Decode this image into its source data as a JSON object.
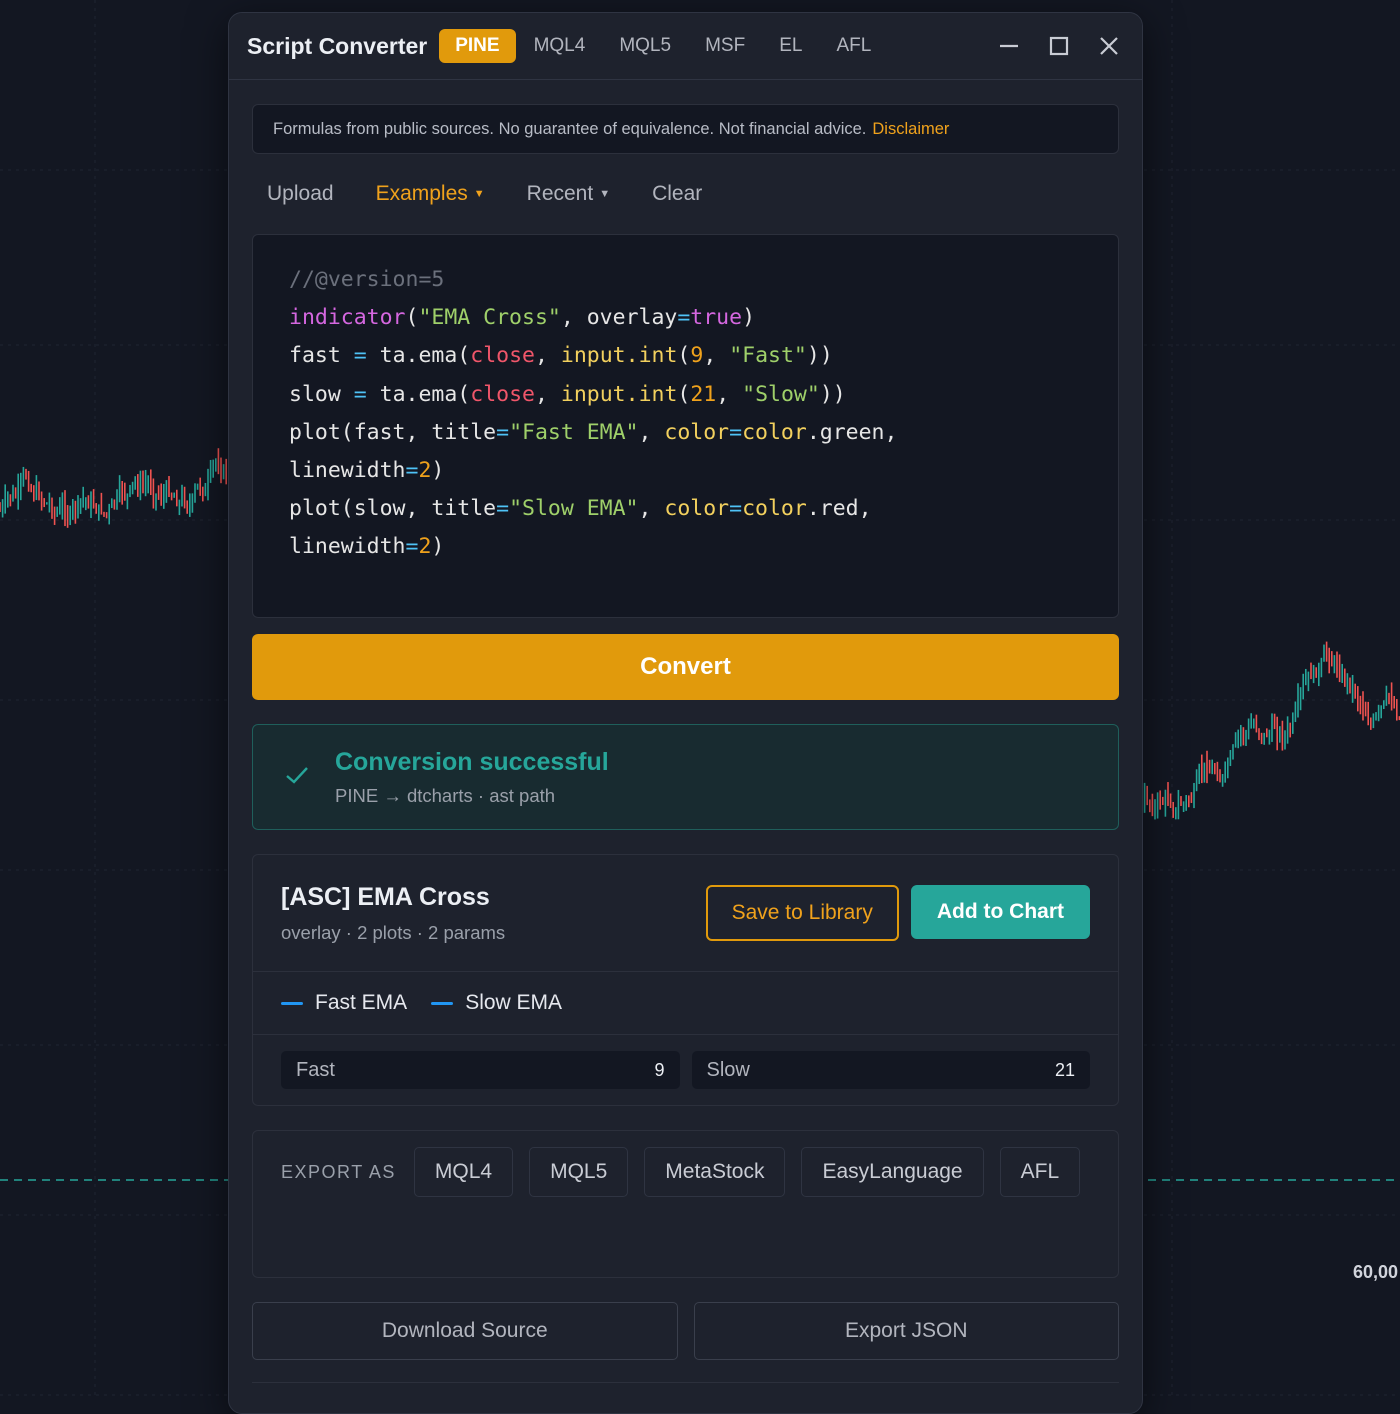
{
  "chart": {
    "price_label": "60,00"
  },
  "window": {
    "title": "Script Converter",
    "lang_tabs": [
      {
        "label": "PINE",
        "active": true
      },
      {
        "label": "MQL4"
      },
      {
        "label": "MQL5"
      },
      {
        "label": "MSF"
      },
      {
        "label": "EL"
      },
      {
        "label": "AFL"
      }
    ],
    "controls": {
      "minimize": "minimize-icon",
      "maximize": "maximize-icon",
      "close": "close-icon"
    }
  },
  "disclaimer": {
    "text": "Formulas from public sources. No guarantee of equivalence. Not financial advice.",
    "link": "Disclaimer"
  },
  "toolbar": {
    "upload": "Upload",
    "examples": "Examples",
    "recent": "Recent",
    "clear": "Clear"
  },
  "editor": {
    "language": "pine",
    "lines": [
      "//@version=5",
      "indicator(\"EMA Cross\", overlay=true)",
      "fast = ta.ema(close, input.int(9, \"Fast\"))",
      "slow = ta.ema(close, input.int(21, \"Slow\"))",
      "plot(fast, title=\"Fast EMA\", color=color.green,",
      "linewidth=2)",
      "plot(slow, title=\"Slow EMA\", color=color.red,",
      "linewidth=2)"
    ]
  },
  "convert": {
    "label": "Convert"
  },
  "status": {
    "title": "Conversion successful",
    "subtitle": "PINE → dtcharts · ast path",
    "color": "#26a69a"
  },
  "result": {
    "title": "[ASC] EMA Cross",
    "meta": "overlay · 2 plots · 2 params",
    "save_label": "Save to Library",
    "add_label": "Add to Chart",
    "plots": [
      {
        "name": "Fast EMA",
        "color": "#2196f3"
      },
      {
        "name": "Slow EMA",
        "color": "#2196f3"
      }
    ],
    "params": [
      {
        "name": "Fast",
        "value": "9"
      },
      {
        "name": "Slow",
        "value": "21"
      }
    ]
  },
  "export": {
    "label": "EXPORT AS",
    "formats": [
      "MQL4",
      "MQL5",
      "MetaStock",
      "EasyLanguage",
      "AFL"
    ]
  },
  "actions": {
    "download": "Download Source",
    "export_json": "Export JSON"
  },
  "colors": {
    "accent": "#e19a0c",
    "success": "#26a69a",
    "background": "#131722",
    "panel": "#1e222d"
  }
}
